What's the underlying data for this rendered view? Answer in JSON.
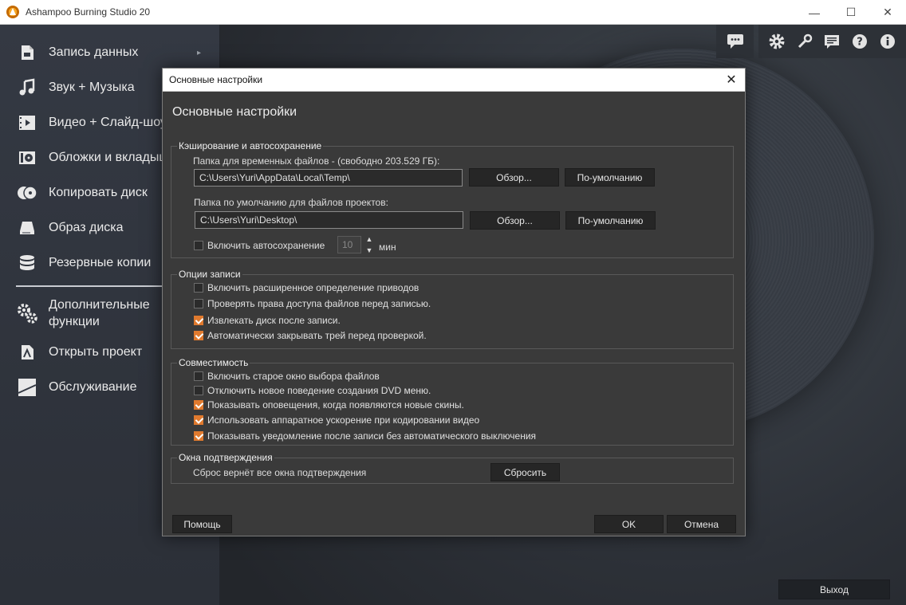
{
  "window": {
    "title": "Ashampoo Burning Studio 20",
    "minimize_glyph": "—",
    "maximize_glyph": "☐",
    "close_glyph": "✕"
  },
  "sidebar": {
    "items": [
      {
        "label": "Запись данных",
        "icon": "document-icon"
      },
      {
        "label": "Звук + Музыка",
        "icon": "music-note-icon"
      },
      {
        "label": "Видео + Слайд-шоу",
        "icon": "film-icon"
      },
      {
        "label": "Обложки и вкладыши",
        "icon": "cover-icon"
      },
      {
        "label": "Копировать диск",
        "icon": "copy-disc-icon"
      },
      {
        "label": "Образ диска",
        "icon": "disk-image-icon"
      },
      {
        "label": "Резервные копии",
        "icon": "database-icon"
      },
      {
        "label": "Дополнительные\nфункции",
        "icon": "gears-icon"
      },
      {
        "label": "Открыть проект",
        "icon": "open-project-icon"
      },
      {
        "label": "Обслуживание",
        "icon": "maintenance-icon"
      }
    ],
    "arrow_glyph": "▸"
  },
  "toolbar": {
    "icons": [
      "chat-icon",
      "gear-icon",
      "wrench-icon",
      "comment-icon",
      "help-icon",
      "info-icon"
    ]
  },
  "exit_button": "Выход",
  "dialog": {
    "title": "Основные настройки",
    "heading": "Основные настройки",
    "close_glyph": "✕",
    "caching": {
      "group_title": "Кэширование и автосохранение",
      "temp_label": "Папка для временных файлов - (свободно 203.529  ГБ):",
      "temp_value": "C:\\Users\\Yuri\\AppData\\Local\\Temp\\",
      "project_label": "Папка по умолчанию для файлов проектов:",
      "project_value": "C:\\Users\\Yuri\\Desktop\\",
      "browse_label": "Обзор...",
      "default_label": "По-умолчанию",
      "autosave_label": "Включить автосохранение",
      "autosave_checked": false,
      "autosave_minutes": "10",
      "minutes_unit": "мин",
      "spin_up": "▲",
      "spin_down": "▼"
    },
    "write_options": {
      "group_title": "Опции записи",
      "items": [
        {
          "label": "Включить расширенное определение приводов",
          "checked": false
        },
        {
          "label": "Проверять права доступа файлов перед записью.",
          "checked": false
        },
        {
          "label": "Извлекать диск после записи.",
          "checked": true
        },
        {
          "label": "Автоматически закрывать трей перед проверкой.",
          "checked": true
        }
      ]
    },
    "compatibility": {
      "group_title": "Совместимость",
      "items": [
        {
          "label": "Включить старое окно выбора файлов",
          "checked": false
        },
        {
          "label": "Отключить новое поведение создания DVD меню.",
          "checked": false
        },
        {
          "label": "Показывать оповещения, когда появляются новые скины.",
          "checked": true
        },
        {
          "label": "Использовать аппаратное ускорение при кодировании видео",
          "checked": true
        },
        {
          "label": "Показывать уведомление после записи без автоматического выключения",
          "checked": true
        }
      ]
    },
    "confirm": {
      "group_title": "Окна подтверждения",
      "text": "Сброс вернёт все окна подтверждения",
      "reset_label": "Сбросить"
    },
    "help_label": "Помощь",
    "ok_label": "OK",
    "cancel_label": "Отмена"
  },
  "colors": {
    "accent_checkbox": "#e07a2e",
    "dialog_bg": "#3a3a3a",
    "sidebar_bg": "#343943"
  }
}
